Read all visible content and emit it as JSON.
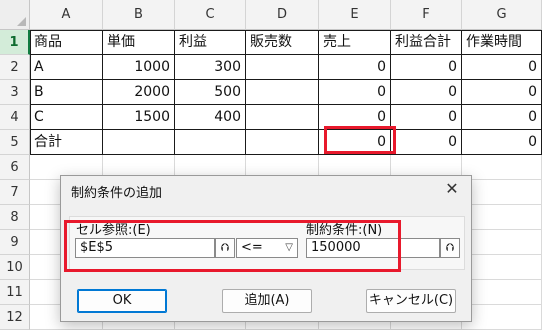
{
  "columns": [
    "A",
    "B",
    "C",
    "D",
    "E",
    "F",
    "G"
  ],
  "rows": [
    "1",
    "2",
    "3",
    "4",
    "5",
    "6",
    "7",
    "8",
    "9",
    "10",
    "11",
    "12"
  ],
  "grid": [
    [
      "商品",
      "単価",
      "利益",
      "販売数",
      "売上",
      "利益合計",
      "作業時間"
    ],
    [
      "A",
      "1000",
      "300",
      "",
      "0",
      "0",
      "0"
    ],
    [
      "B",
      "2000",
      "500",
      "",
      "0",
      "0",
      "0"
    ],
    [
      "C",
      "1500",
      "400",
      "",
      "0",
      "0",
      "0"
    ],
    [
      "合計",
      "",
      "",
      "",
      "0",
      "0",
      "0"
    ]
  ],
  "dialog": {
    "title": "制約条件の追加",
    "close_glyph": "✕",
    "cell_ref_label": "セル参照:(E)",
    "cell_ref_value": "$E$5",
    "operator": "<=",
    "constraint_label": "制約条件:(N)",
    "constraint_value": "150000",
    "ok_label": "OK",
    "add_label": "追加(A)",
    "cancel_label": "キャンセル(C)"
  },
  "colors": {
    "highlight": "#e8192c",
    "active_row": "#d3ecd9"
  },
  "icons": {
    "collapse": "collapse-dialog-icon",
    "dropdown": "chevron-down-icon"
  }
}
